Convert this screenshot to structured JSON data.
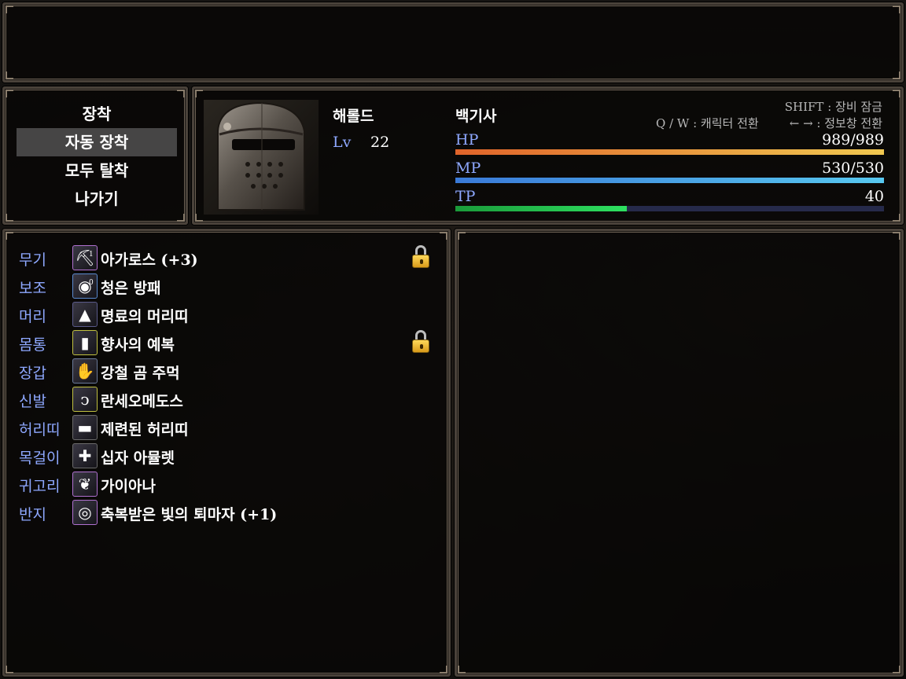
{
  "command": {
    "items": [
      "장착",
      "자동 장착",
      "모두 탈착",
      "나가기"
    ],
    "selected_index": 1
  },
  "actor": {
    "name": "해롤드",
    "level_label": "Lv",
    "level": "22",
    "class": "백기사"
  },
  "hints": {
    "lock": "SHIFT : 장비 잠금",
    "switch_char": "Q / W : 캐릭터 전환",
    "switch_info": "← → : 정보창 전환"
  },
  "gauges": {
    "hp": {
      "label": "HP",
      "text": "989/989",
      "ratio": 1.0,
      "colors": [
        "#e0642a",
        "#f0c850"
      ]
    },
    "mp": {
      "label": "MP",
      "text": "530/530",
      "ratio": 1.0,
      "colors": [
        "#3a7ad8",
        "#58c8f0"
      ]
    },
    "tp": {
      "label": "TP",
      "text": "40",
      "ratio": 0.4,
      "colors": [
        "#1a9a3a",
        "#2ee060"
      ]
    }
  },
  "equipment": [
    {
      "slot": "무기",
      "item": "아가로스 (+3)",
      "icon": "pickaxe-icon",
      "glyph": "⛏",
      "sup": "1",
      "locked": true,
      "frame": "#b070d0"
    },
    {
      "slot": "보조",
      "item": "청은 방패",
      "icon": "round-shield-icon",
      "glyph": "◉",
      "sup": "0",
      "locked": false,
      "frame": "#5a8ad0"
    },
    {
      "slot": "머리",
      "item": "명료의 머리띠",
      "icon": "hood-icon",
      "glyph": "▲",
      "sup": "",
      "locked": false,
      "frame": "#5a5a8a"
    },
    {
      "slot": "몸통",
      "item": "향사의 예복",
      "icon": "robe-icon",
      "glyph": "▮",
      "sup": "",
      "locked": true,
      "frame": "#c0c040"
    },
    {
      "slot": "장갑",
      "item": "강철 곰 주먹",
      "icon": "gauntlet-icon",
      "glyph": "✋",
      "sup": "",
      "locked": false,
      "frame": "#6a7a9a"
    },
    {
      "slot": "신발",
      "item": "란세오메도스",
      "icon": "boots-icon",
      "glyph": "ↄ",
      "sup": "",
      "locked": false,
      "frame": "#c0c040"
    },
    {
      "slot": "허리띠",
      "item": "제련된 허리띠",
      "icon": "belt-icon",
      "glyph": "▬",
      "sup": "",
      "locked": false,
      "frame": "#6a6a6a"
    },
    {
      "slot": "목걸이",
      "item": "십자 아뮬렛",
      "icon": "amulet-icon",
      "glyph": "✚",
      "sup": "",
      "locked": false,
      "frame": "#6a6a6a"
    },
    {
      "slot": "귀고리",
      "item": "가이아나",
      "icon": "earring-icon",
      "glyph": "❦",
      "sup": "",
      "locked": false,
      "frame": "#b070d0"
    },
    {
      "slot": "반지",
      "item": "축복받은 빛의 퇴마자 (+1)",
      "icon": "ring-icon",
      "glyph": "◎",
      "sup": "",
      "locked": false,
      "frame": "#b070d0"
    }
  ]
}
